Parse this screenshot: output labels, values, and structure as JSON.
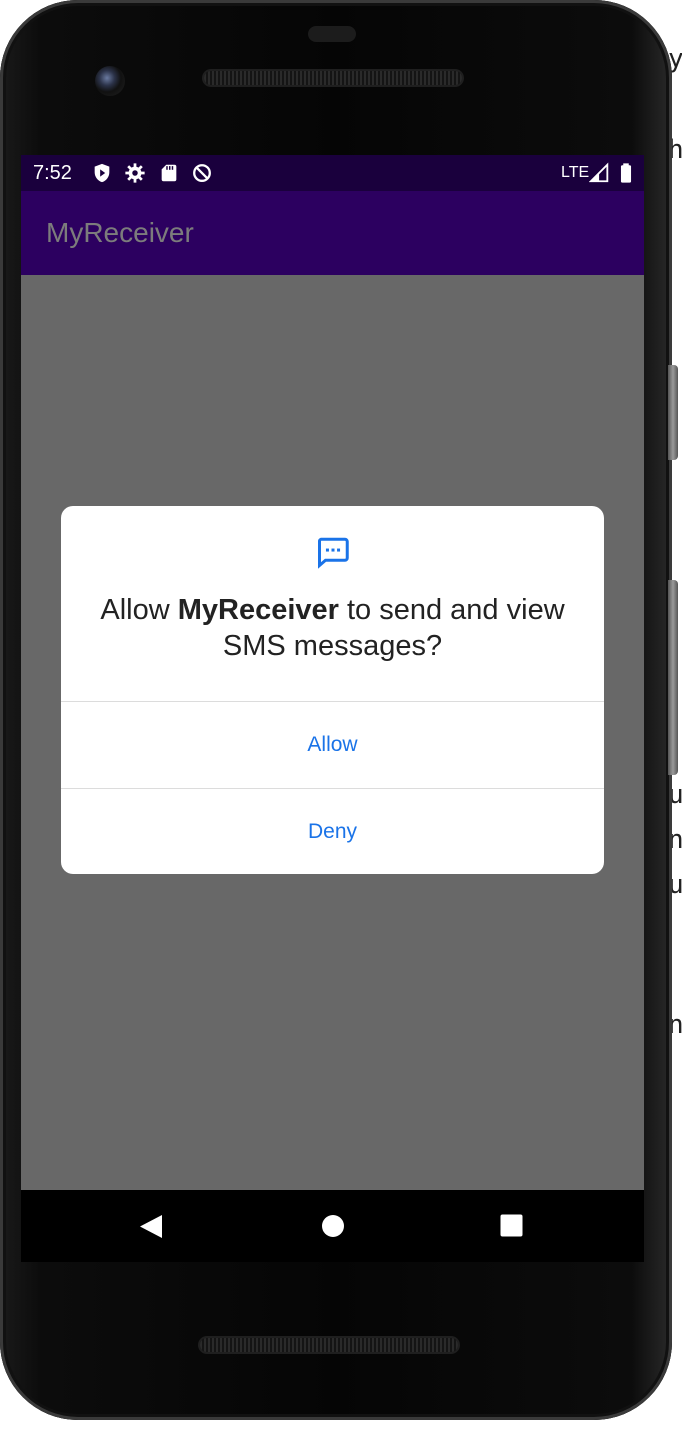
{
  "status_bar": {
    "time": "7:52",
    "network": "LTE",
    "icons": [
      "shield-play-icon",
      "gear-icon",
      "sd-card-icon",
      "do-not-disturb-icon",
      "signal-icon",
      "battery-icon"
    ]
  },
  "app_bar": {
    "title": "MyReceiver"
  },
  "dialog": {
    "icon": "sms-message-icon",
    "message_prefix": "Allow ",
    "app_name": "MyReceiver",
    "message_suffix": " to send and view SMS messages?",
    "allow_label": "Allow",
    "deny_label": "Deny",
    "accent_color": "#1a73e8"
  },
  "nav_bar": {
    "items": [
      "back-icon",
      "home-icon",
      "recents-icon"
    ]
  },
  "colors": {
    "status_bar": "#1a003d",
    "app_bar": "#2c0060",
    "scrim": "#686868"
  }
}
